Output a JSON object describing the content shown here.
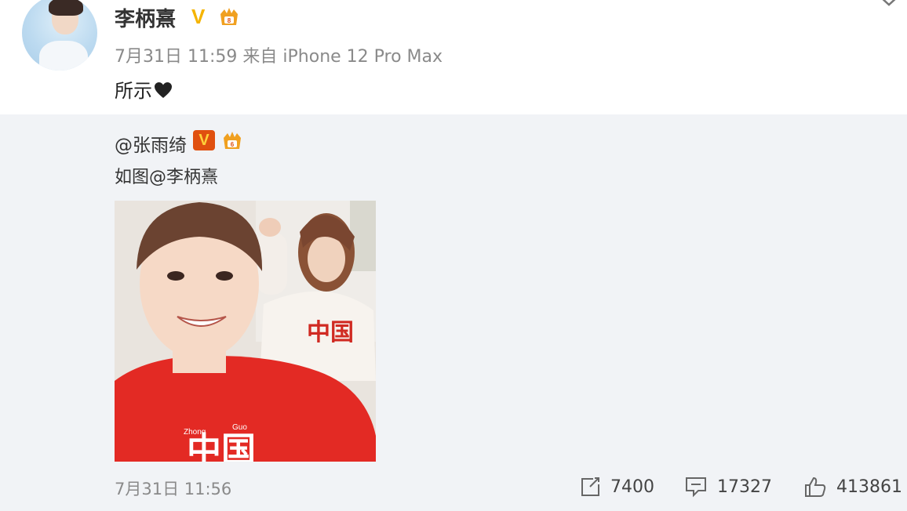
{
  "post": {
    "username": "李柄熹",
    "verified_badge": "V",
    "timestamp": "7月31日 11:59",
    "source_prefix": "来自",
    "source_device": "iPhone 12 Pro Max",
    "text": "所示",
    "emoji": "heart-icon"
  },
  "repost": {
    "username": "@张雨绮",
    "verified_badge": "V",
    "text_prefix": "如图",
    "mention": "@李柄熹",
    "timestamp": "7月31日 11:56",
    "actions": {
      "share_count": "7400",
      "comment_count": "17327",
      "like_count": "413861"
    }
  },
  "colors": {
    "badge_gold": "#f5b400",
    "badge_orange": "#e0500f",
    "repost_bg": "#f1f3f6",
    "meta_gray": "#8a8a8a",
    "shirt_red": "#e32a24"
  }
}
